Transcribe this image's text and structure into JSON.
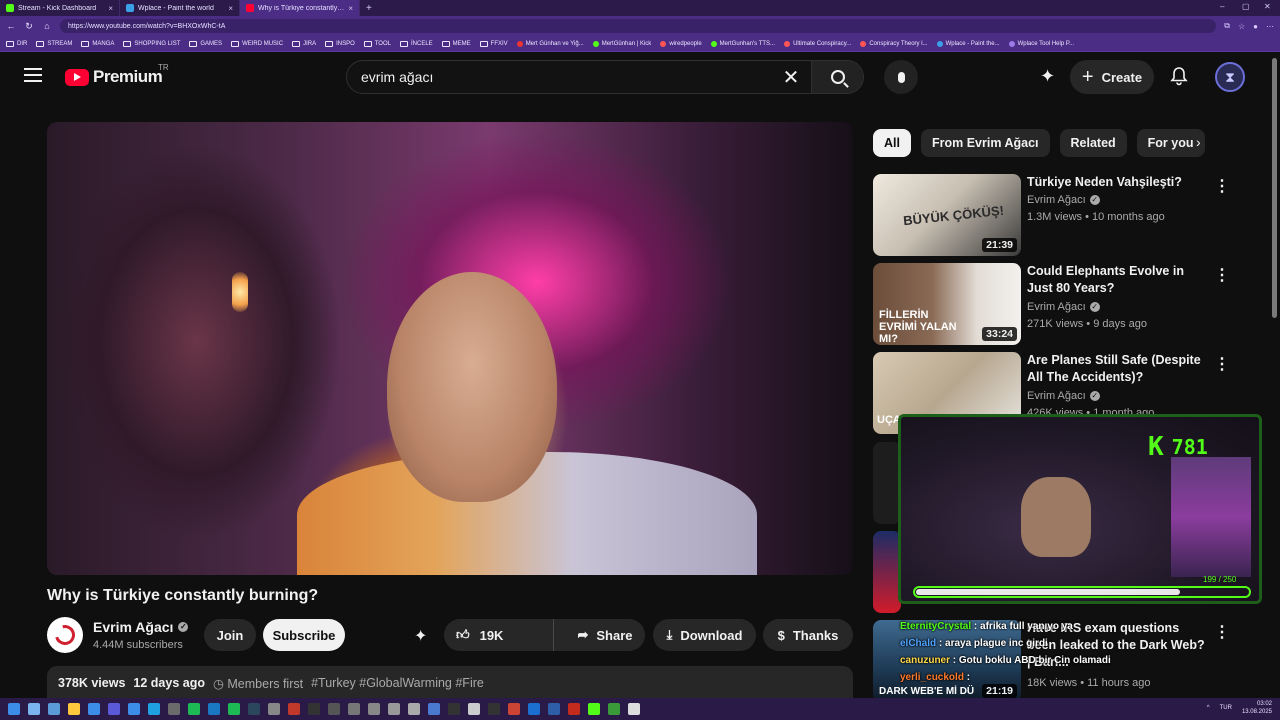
{
  "browser": {
    "tabs": [
      {
        "label": "Stream - Kick Dashboard",
        "color": "#53fc18",
        "active": false
      },
      {
        "label": "Wplace - Paint the world",
        "color": "#3aa0e8",
        "active": false
      },
      {
        "label": "Why is Türkiye constantly bu...",
        "color": "#ff0033",
        "active": true
      }
    ],
    "new_tab": "+",
    "url": "https://www.youtube.com/watch?v=BHXOxWhC-tA",
    "bookmarks": [
      {
        "label": "DIR",
        "type": "folder"
      },
      {
        "label": "STREAM",
        "type": "folder"
      },
      {
        "label": "MANGA",
        "type": "folder"
      },
      {
        "label": "SHOPPING LIST",
        "type": "folder"
      },
      {
        "label": "GAMES",
        "type": "folder"
      },
      {
        "label": "WEIRD MUSIC",
        "type": "folder"
      },
      {
        "label": "JIRA",
        "type": "folder"
      },
      {
        "label": "INSPO",
        "type": "folder"
      },
      {
        "label": "TOOL",
        "type": "folder"
      },
      {
        "label": "İNCELE",
        "type": "folder"
      },
      {
        "label": "MEME",
        "type": "folder"
      },
      {
        "label": "FFXIV",
        "type": "folder"
      },
      {
        "label": "Mert Günhan ve Yiğ...",
        "type": "link",
        "color": "#e33"
      },
      {
        "label": "MertGünhan | Kick",
        "type": "link",
        "color": "#53fc18"
      },
      {
        "label": "wiredpeople",
        "type": "link",
        "color": "#f55"
      },
      {
        "label": "MertGunhan's TTS...",
        "type": "link",
        "color": "#53fc18"
      },
      {
        "label": "Ultimate Conspiracy...",
        "type": "link",
        "color": "#f55"
      },
      {
        "label": "Conspiracy Theory l...",
        "type": "link",
        "color": "#f55"
      },
      {
        "label": "Wplace - Paint the...",
        "type": "link",
        "color": "#3aa0e8"
      },
      {
        "label": "Wplace Tool Help P...",
        "type": "link",
        "color": "#9b7be8"
      }
    ]
  },
  "header": {
    "logo_text": "Premium",
    "country_code": "TR",
    "search_value": "evrim ağacı",
    "create_label": "Create"
  },
  "video": {
    "title": "Why is Türkiye constantly burning?",
    "channel": "Evrim Ağacı",
    "subscribers": "4.44M subscribers",
    "join_label": "Join",
    "subscribe_label": "Subscribe",
    "likes": "19K",
    "share_label": "Share",
    "download_label": "Download",
    "thanks_label": "Thanks",
    "views": "378K views",
    "age": "12 days ago",
    "members": "Members first",
    "tags": "#Turkey #GlobalWarming #Fire"
  },
  "chips": [
    "All",
    "From Evrim Ağacı",
    "Related",
    "For you"
  ],
  "recommendations": [
    {
      "title": "Türkiye Neden Vahşileşti?",
      "channel": "Evrim Ağacı",
      "meta": "1.3M views • 10 months ago",
      "duration": "21:39",
      "thumb_colors": [
        "#e8e2d8",
        "#2b2b2b"
      ],
      "thumb_text": "BÜYÜK ÇÖKÜŞ!"
    },
    {
      "title": "Could Elephants Evolve in Just 80 Years?",
      "channel": "Evrim Ağacı",
      "meta": "271K views • 9 days ago",
      "duration": "33:24",
      "thumb_colors": [
        "#7a5a44",
        "#cfc8c0"
      ],
      "thumb_text": "FİLLERİN EVRİMİ YALAN MI?"
    },
    {
      "title": "Are Planes Still Safe (Despite All The Accidents)?",
      "channel": "Evrim Ağacı",
      "meta": "426K views • 1 month ago",
      "duration": "",
      "thumb_colors": [
        "#c9b9a3",
        "#e6e6e6"
      ],
      "thumb_text": "UÇA"
    },
    {
      "title": "Have IRS exam questions been leaked to the Dark Web? | Barı...",
      "channel": "",
      "meta": "18K views • 11 hours ago",
      "duration": "21:19",
      "thumb_colors": [
        "#2a4a6a",
        "#d8d8d8"
      ],
      "thumb_text": "DARK WEB'E Mİ DÜ"
    }
  ],
  "stream": {
    "kick_count": "781",
    "progress_text": "199 / 250",
    "progress_fraction": 0.796
  },
  "chat": [
    {
      "user": "EternityCrystal",
      "user_color": "#53fc18",
      "message": ": afrika full yanıyo ya"
    },
    {
      "user": "elChald",
      "user_color": "#4fa3ff",
      "message": ": araya plague inc girdi"
    },
    {
      "user": "canuzuner",
      "user_color": "#ffd84a",
      "message": ": Gotu boklu ABD bir Cin olamadi"
    },
    {
      "user": "yerli_cuckold",
      "user_color": "#ff7a2a",
      "message": ":"
    }
  ],
  "taskbar": {
    "lang": "TUR",
    "time": "03:02",
    "date": "13.08.2025"
  }
}
